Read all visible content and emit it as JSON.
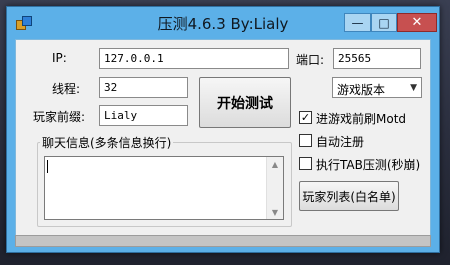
{
  "window": {
    "title": "压测4.6.3   By:Lialy",
    "min_glyph": "—",
    "max_glyph": "□",
    "close_glyph": "✕"
  },
  "form": {
    "ip_label": "IP:",
    "ip_value": "127.0.0.1",
    "port_label": "端口:",
    "port_value": "25565",
    "threads_label": "线程:",
    "threads_value": "32",
    "prefix_label": "玩家前缀:",
    "prefix_value": "Lialy",
    "version_value": "游戏版本",
    "start_button": "开始测试"
  },
  "options": [
    {
      "label": "进游戏前刷Motd",
      "checked": true
    },
    {
      "label": "自动注册",
      "checked": false
    },
    {
      "label": "执行TAB压测(秒崩)",
      "checked": false
    }
  ],
  "chat": {
    "group_title": "聊天信息(多条信息换行)",
    "value": ""
  },
  "player_list_button": "玩家列表(白名单)"
}
